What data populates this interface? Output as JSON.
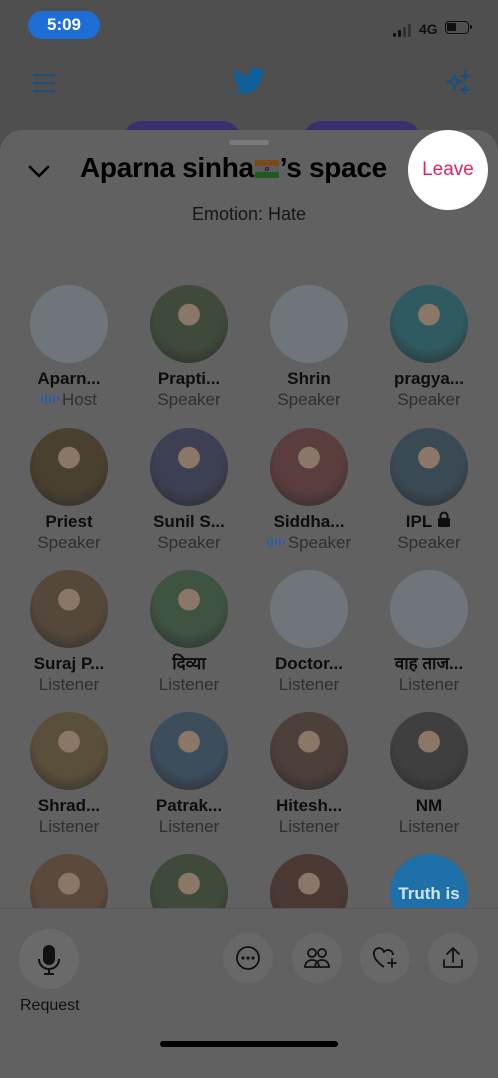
{
  "status": {
    "time": "5:09",
    "network": "4G"
  },
  "space": {
    "host_name": "Aparna sinha",
    "title_suffix": "’s space",
    "subtitle": "Emotion: Hate",
    "leave_label": "Leave"
  },
  "participants": [
    {
      "name": "Aparn...",
      "role": "Host",
      "speaking": true,
      "photo": false
    },
    {
      "name": "Prapti...",
      "role": "Speaker",
      "speaking": false,
      "photo": true
    },
    {
      "name": "Shrin",
      "role": "Speaker",
      "speaking": false,
      "photo": false
    },
    {
      "name": "pragya...",
      "role": "Speaker",
      "speaking": false,
      "photo": true
    },
    {
      "name": "Priest",
      "role": "Speaker",
      "speaking": false,
      "photo": true
    },
    {
      "name": "Sunil S...",
      "role": "Speaker",
      "speaking": false,
      "photo": true
    },
    {
      "name": "Siddha...",
      "role": "Speaker",
      "speaking": true,
      "photo": true
    },
    {
      "name": "IPL",
      "role": "Speaker",
      "speaking": false,
      "photo": true,
      "locked": true
    },
    {
      "name": "Suraj P...",
      "role": "Listener",
      "speaking": false,
      "photo": true
    },
    {
      "name": "दिव्या",
      "role": "Listener",
      "speaking": false,
      "photo": true
    },
    {
      "name": "Doctor...",
      "role": "Listener",
      "speaking": false,
      "photo": false
    },
    {
      "name": "वाह ताज...",
      "role": "Listener",
      "speaking": false,
      "photo": false
    },
    {
      "name": "Shrad...",
      "role": "Listener",
      "speaking": false,
      "photo": true
    },
    {
      "name": "Patrak...",
      "role": "Listener",
      "speaking": false,
      "photo": true
    },
    {
      "name": "Hitesh...",
      "role": "Listener",
      "speaking": false,
      "photo": true
    },
    {
      "name": "NM",
      "role": "Listener",
      "speaking": false,
      "photo": true
    },
    {
      "name": "",
      "role": "",
      "photo": true
    },
    {
      "name": "",
      "role": "",
      "photo": true
    },
    {
      "name": "",
      "role": "",
      "photo": true
    },
    {
      "name": "",
      "role": "",
      "photo": true,
      "avatar_text": "Truth is"
    }
  ],
  "bottom_bar": {
    "request_label": "Request"
  },
  "icons": [
    "menu-icon",
    "twitter-bird-icon",
    "sparkle-icon",
    "chevron-down-icon",
    "lock-icon",
    "speaking-wave-icon",
    "microphone-icon",
    "more-icon",
    "people-icon",
    "heart-plus-icon",
    "share-icon"
  ],
  "colors": {
    "leave_red": "#e0245e",
    "twitter_blue": "#1d9bf0"
  }
}
